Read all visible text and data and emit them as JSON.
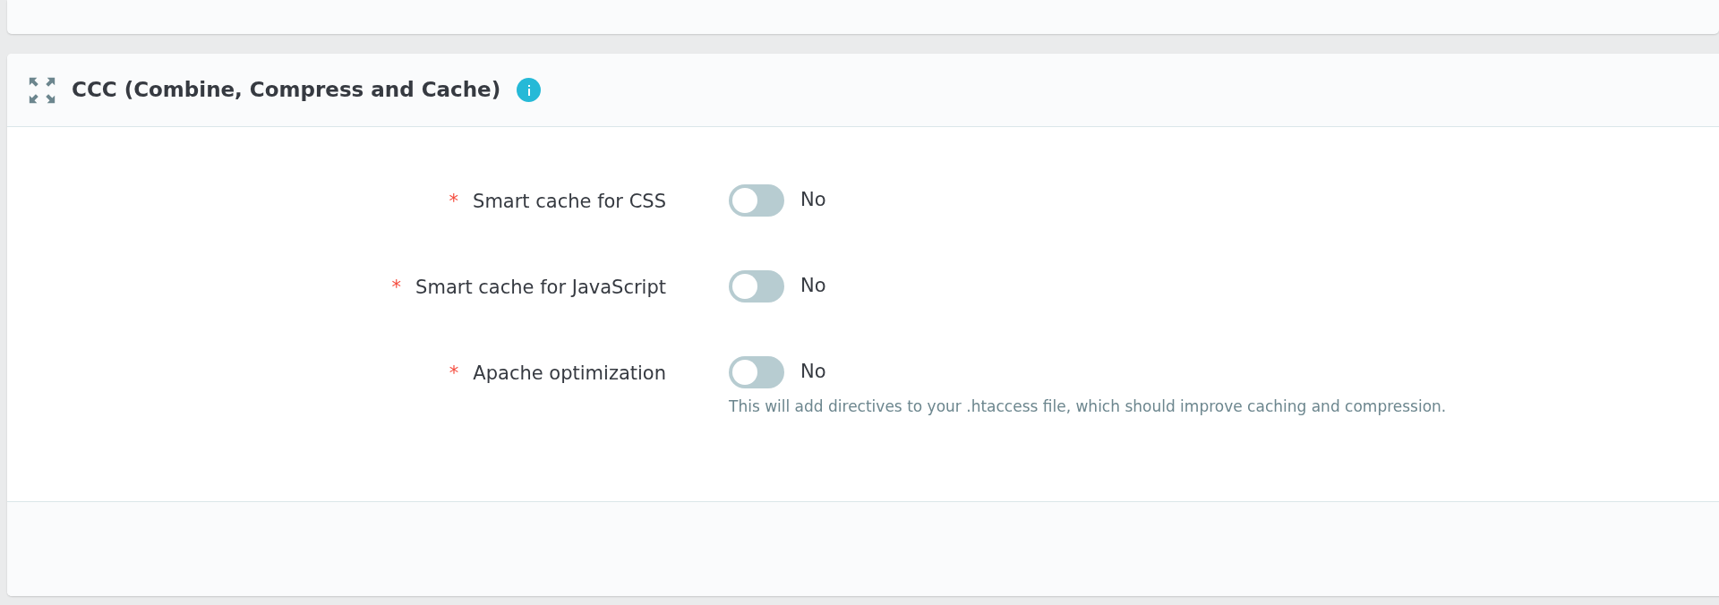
{
  "panel": {
    "title": "CCC (Combine, Compress and Cache)",
    "fields": [
      {
        "label": "Smart cache for CSS",
        "required_mark": "*",
        "on": false,
        "state_text": "No"
      },
      {
        "label": "Smart cache for JavaScript",
        "required_mark": "*",
        "on": false,
        "state_text": "No"
      },
      {
        "label": "Apache optimization",
        "required_mark": "*",
        "on": false,
        "state_text": "No",
        "help": "This will add directives to your .htaccess file, which should improve caching and compression."
      }
    ]
  }
}
